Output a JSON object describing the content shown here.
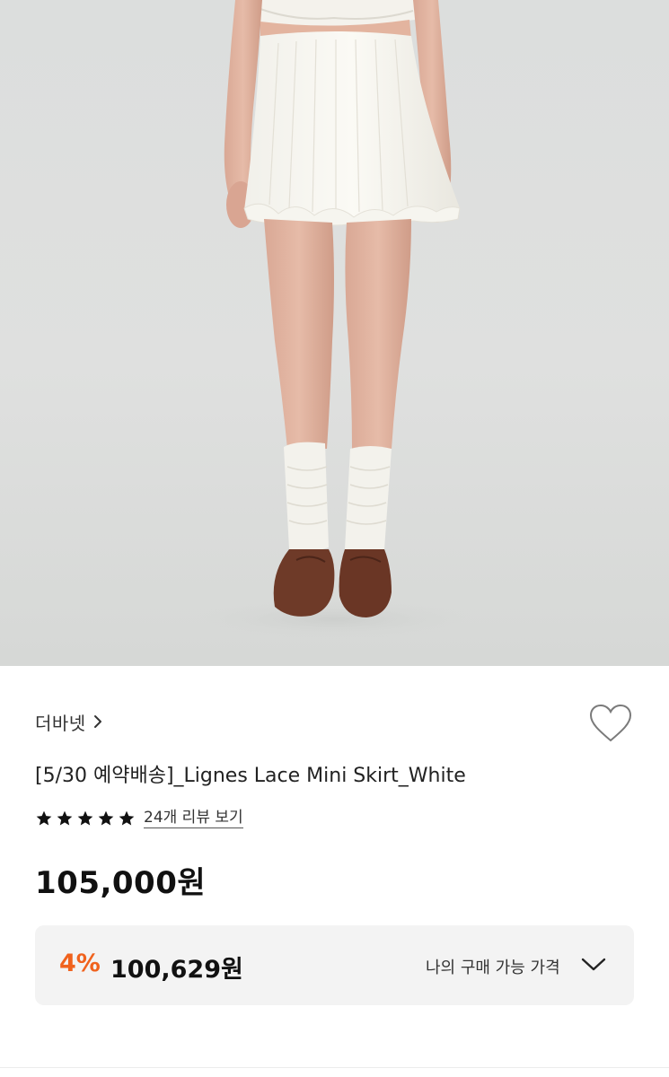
{
  "product": {
    "brand": "더바넷",
    "title": "[5/30 예약배송]_Lignes Lace Mini Skirt_White",
    "review_link": "24개 리뷰 보기",
    "rating_stars": 5,
    "price": "105,000원"
  },
  "benefit": {
    "discount": "4%",
    "discounted_price": "100,629원",
    "label": "나의 구매 가능 가격"
  },
  "icons": {
    "brand_chevron": "chevron-right-icon",
    "wishlist": "heart-outline-icon",
    "star": "star-icon",
    "expand": "chevron-down-icon"
  },
  "colors": {
    "discount": "#f0621d",
    "benefit_bg": "#f3f3f3",
    "star": "#111111"
  }
}
